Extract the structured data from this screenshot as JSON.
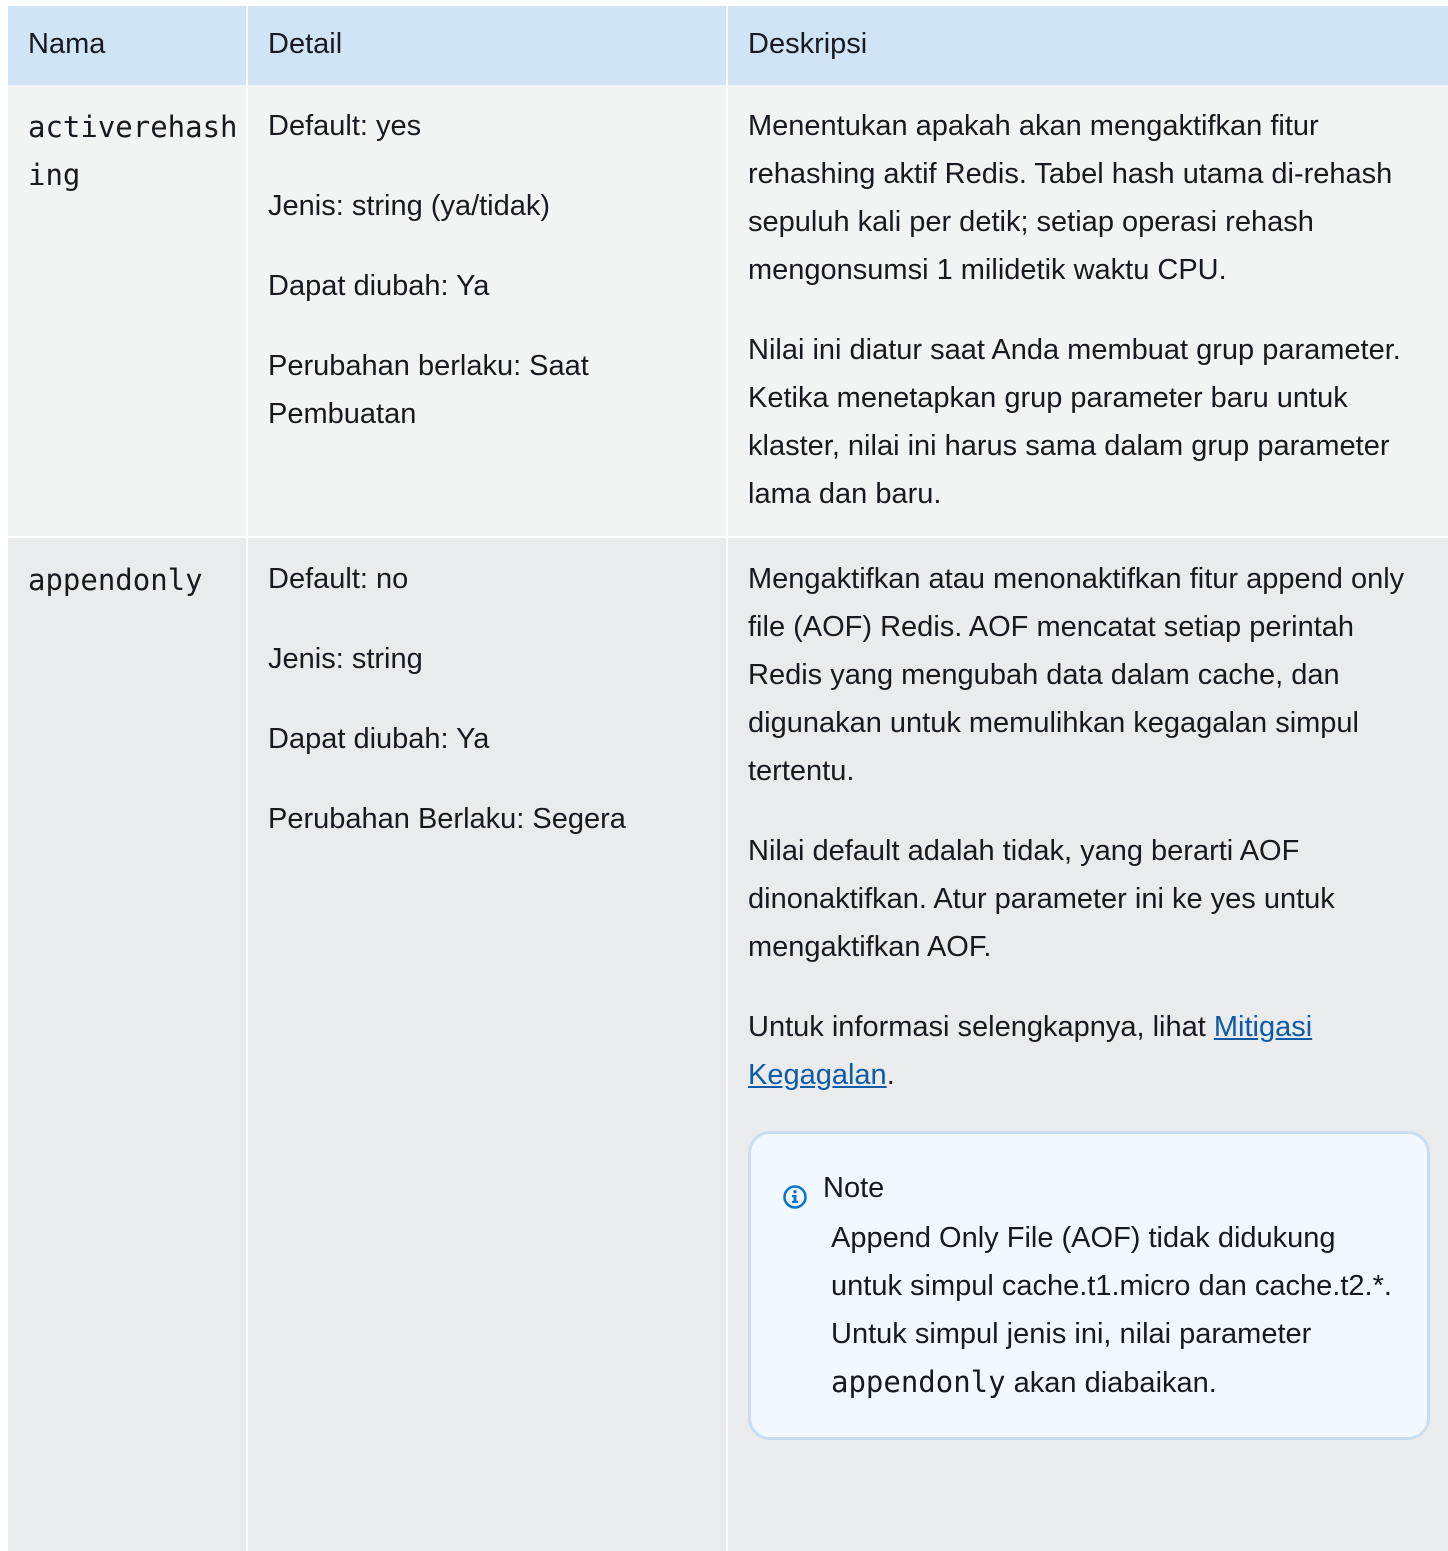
{
  "table": {
    "headers": {
      "name": "Nama",
      "detail": "Detail",
      "description": "Deskripsi"
    },
    "rows": [
      {
        "name": "activerehashing",
        "details": [
          "Default: yes",
          "Jenis: string (ya/tidak)",
          "Dapat diubah: Ya",
          "Perubahan berlaku: Saat Pembuatan"
        ],
        "description": [
          "Menentukan apakah akan mengaktifkan fitur rehashing aktif Redis. Tabel hash utama di-rehash sepuluh kali per detik; setiap operasi rehash mengonsumsi 1 milidetik waktu CPU.",
          "Nilai ini diatur saat Anda membuat grup parameter. Ketika menetapkan grup parameter baru untuk klaster, nilai ini harus sama dalam grup parameter lama dan baru."
        ]
      },
      {
        "name": "appendonly",
        "details": [
          "Default: no",
          "Jenis: string",
          "Dapat diubah: Ya",
          "Perubahan Berlaku: Segera"
        ],
        "description": [
          "Mengaktifkan atau menonaktifkan fitur append only file (AOF) Redis. AOF mencatat setiap perintah Redis yang mengubah data dalam cache, dan digunakan untuk memulihkan kegagalan simpul tertentu.",
          "Nilai default adalah tidak, yang berarti AOF dinonaktifkan. Atur parameter ini ke yes untuk mengaktifkan AOF."
        ],
        "more_info": {
          "prefix": "Untuk informasi selengkapnya, lihat ",
          "link_text": "Mitigasi Kegagalan",
          "suffix": "."
        },
        "note": {
          "title": "Note",
          "text_before": "Append Only File (AOF) tidak didukung untuk simpul cache.t1.micro dan cache.t2.*. Untuk simpul jenis ini, nilai parameter ",
          "code": "appendonly",
          "text_after": " akan diabaikan."
        }
      }
    ]
  },
  "icons": {
    "note": "info-icon"
  },
  "colors": {
    "header_bg": "#d1e4f6",
    "row1_bg": "#f2f3f3",
    "row2_bg": "#e9ebed",
    "link": "#0d5aa7",
    "note_bg": "#f1f8ff",
    "note_border": "#c9ddf2",
    "icon": "#0972d3"
  }
}
